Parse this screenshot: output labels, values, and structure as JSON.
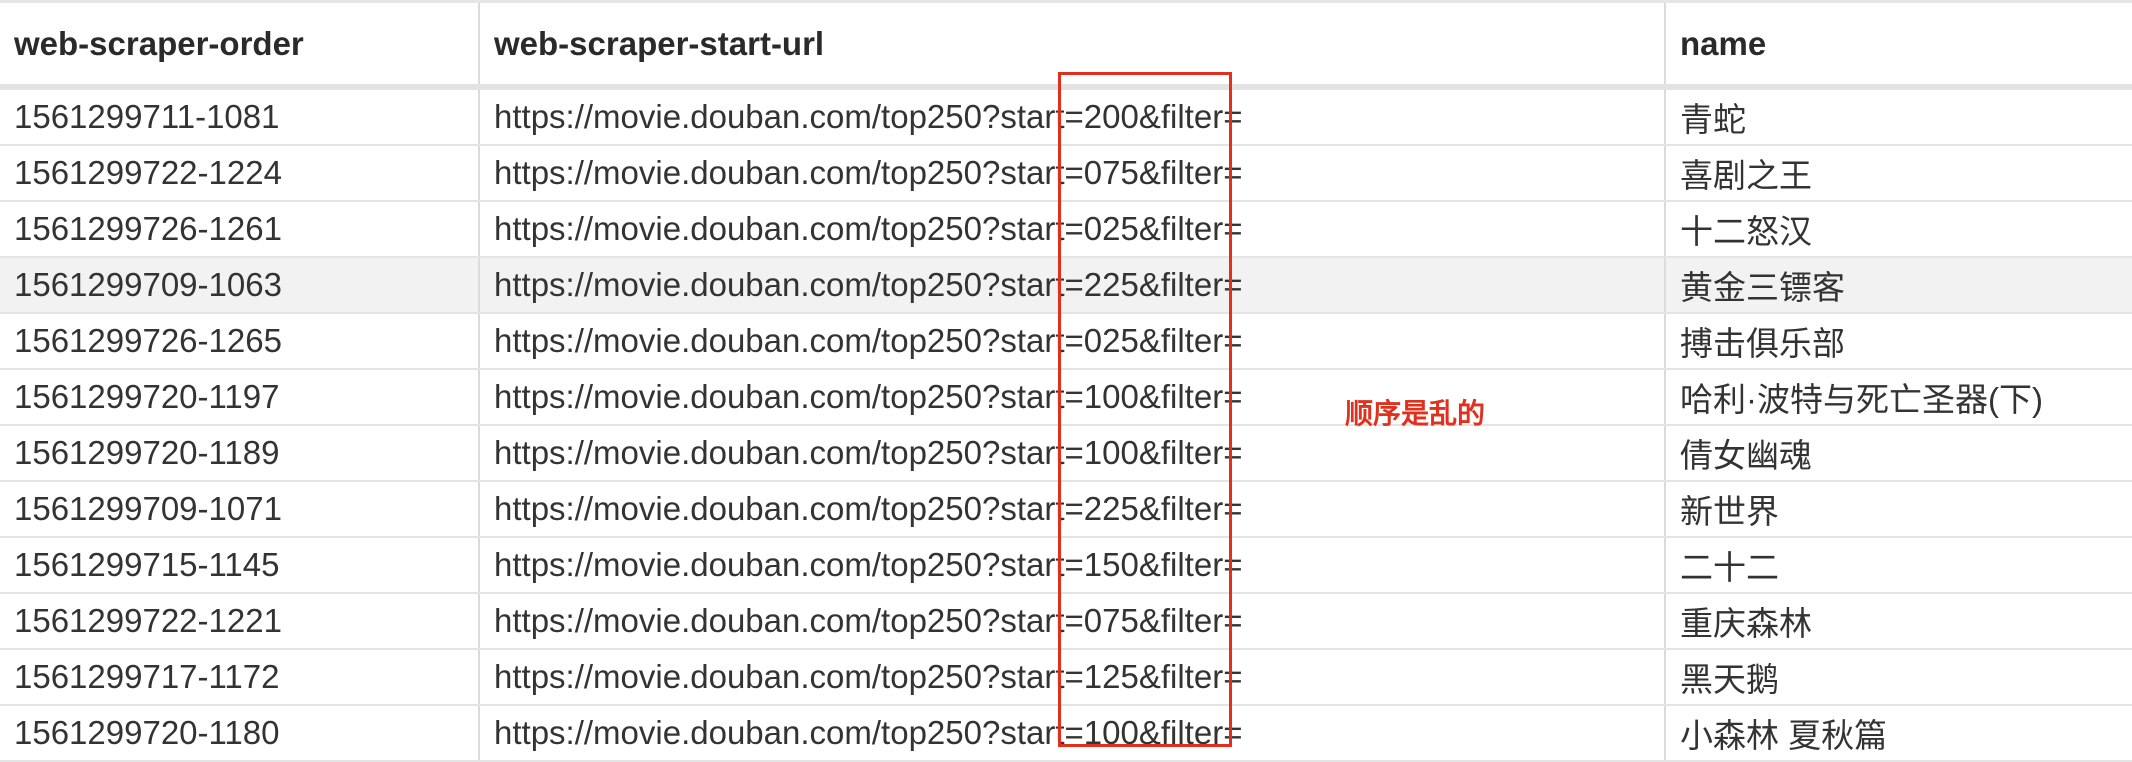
{
  "table": {
    "columns": [
      "web-scraper-order",
      "web-scraper-start-url",
      "name"
    ],
    "rows": [
      {
        "order": "1561299711-1081",
        "url": "https://movie.douban.com/top250?start=200&filter=",
        "name": "青蛇",
        "highlighted": false
      },
      {
        "order": "1561299722-1224",
        "url": "https://movie.douban.com/top250?start=075&filter=",
        "name": "喜剧之王",
        "highlighted": false
      },
      {
        "order": "1561299726-1261",
        "url": "https://movie.douban.com/top250?start=025&filter=",
        "name": "十二怒汉",
        "highlighted": false
      },
      {
        "order": "1561299709-1063",
        "url": "https://movie.douban.com/top250?start=225&filter=",
        "name": "黄金三镖客",
        "highlighted": true
      },
      {
        "order": "1561299726-1265",
        "url": "https://movie.douban.com/top250?start=025&filter=",
        "name": "搏击俱乐部",
        "highlighted": false
      },
      {
        "order": "1561299720-1197",
        "url": "https://movie.douban.com/top250?start=100&filter=",
        "name": "哈利·波特与死亡圣器(下)",
        "highlighted": false
      },
      {
        "order": "1561299720-1189",
        "url": "https://movie.douban.com/top250?start=100&filter=",
        "name": "倩女幽魂",
        "highlighted": false
      },
      {
        "order": "1561299709-1071",
        "url": "https://movie.douban.com/top250?start=225&filter=",
        "name": "新世界",
        "highlighted": false
      },
      {
        "order": "1561299715-1145",
        "url": "https://movie.douban.com/top250?start=150&filter=",
        "name": "二十二",
        "highlighted": false
      },
      {
        "order": "1561299722-1221",
        "url": "https://movie.douban.com/top250?start=075&filter=",
        "name": "重庆森林",
        "highlighted": false
      },
      {
        "order": "1561299717-1172",
        "url": "https://movie.douban.com/top250?start=125&filter=",
        "name": "黑天鹅",
        "highlighted": false
      },
      {
        "order": "1561299720-1180",
        "url": "https://movie.douban.com/top250?start=100&filter=",
        "name": "小森林 夏秋篇",
        "highlighted": false
      }
    ]
  },
  "annotation": {
    "note": "顺序是乱的",
    "color": "#e0301e"
  }
}
